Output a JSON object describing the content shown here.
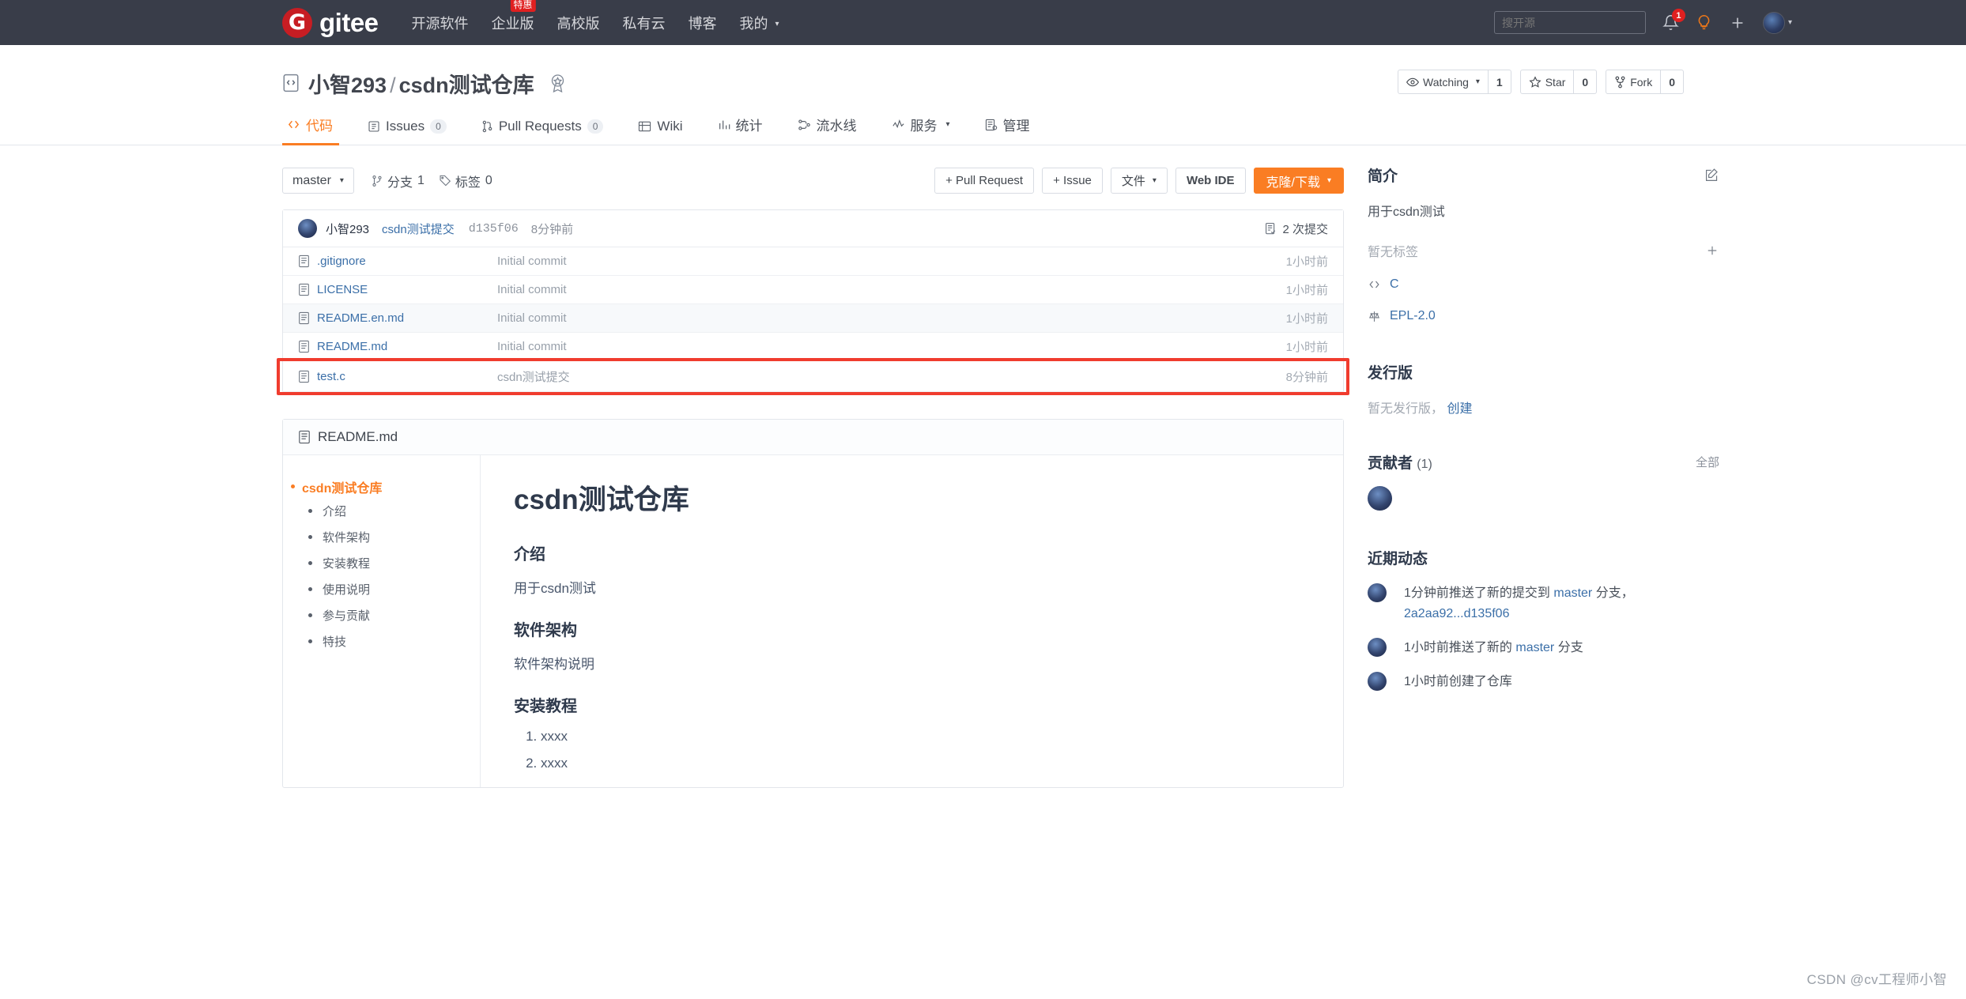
{
  "header": {
    "brand": "gitee",
    "logo_letter": "G",
    "nav": [
      {
        "label": "开源软件",
        "badge": null
      },
      {
        "label": "企业版",
        "badge": "特惠"
      },
      {
        "label": "高校版",
        "badge": null
      },
      {
        "label": "私有云",
        "badge": null
      },
      {
        "label": "博客",
        "badge": null
      },
      {
        "label": "我的",
        "badge": null,
        "caret": true
      }
    ],
    "search_placeholder": "搜开源",
    "notification_count": "1",
    "icons": {
      "bell": "bell-icon",
      "bulb": "lightbulb-icon",
      "plus": "plus-icon",
      "avatar": "user-avatar"
    }
  },
  "repo": {
    "owner": "小智293",
    "separator": "/",
    "name": "csdn测试仓库",
    "watch_label": "Watching",
    "watch_count": "1",
    "star_label": "Star",
    "star_count": "0",
    "fork_label": "Fork",
    "fork_count": "0"
  },
  "tabs": [
    {
      "label": "代码",
      "count": null,
      "active": true
    },
    {
      "label": "Issues",
      "count": "0",
      "active": false
    },
    {
      "label": "Pull Requests",
      "count": "0",
      "active": false
    },
    {
      "label": "Wiki",
      "count": null,
      "active": false
    },
    {
      "label": "统计",
      "count": null,
      "active": false
    },
    {
      "label": "流水线",
      "count": null,
      "active": false
    },
    {
      "label": "服务",
      "count": null,
      "active": false,
      "caret": true
    },
    {
      "label": "管理",
      "count": null,
      "active": false
    }
  ],
  "toolbar": {
    "branch": "master",
    "branches_label": "分支",
    "branches_count": "1",
    "tags_label": "标签",
    "tags_count": "0",
    "pull_request_btn": "+ Pull Request",
    "issue_btn": "+ Issue",
    "files_btn": "文件",
    "webide_btn": "Web IDE",
    "clone_btn": "克隆/下载"
  },
  "commit_bar": {
    "author": "小智293",
    "message": "csdn测试提交",
    "sha": "d135f06",
    "time": "8分钟前",
    "commits_count_label": "2 次提交"
  },
  "files": [
    {
      "name": ".gitignore",
      "message": "Initial commit",
      "time": "1小时前"
    },
    {
      "name": "LICENSE",
      "message": "Initial commit",
      "time": "1小时前"
    },
    {
      "name": "README.en.md",
      "message": "Initial commit",
      "time": "1小时前"
    },
    {
      "name": "README.md",
      "message": "Initial commit",
      "time": "1小时前"
    },
    {
      "name": "test.c",
      "message": "csdn测试提交",
      "time": "8分钟前",
      "highlighted": true
    }
  ],
  "readme": {
    "filename": "README.md",
    "toc_root": "csdn测试仓库",
    "toc_items": [
      "介绍",
      "软件架构",
      "安装教程",
      "使用说明",
      "参与贡献",
      "特技"
    ],
    "title": "csdn测试仓库",
    "sections": [
      {
        "heading": "介绍",
        "text": "用于csdn测试"
      },
      {
        "heading": "软件架构",
        "text": "软件架构说明"
      }
    ],
    "install_heading": "安装教程",
    "install_steps": [
      "xxxx",
      "xxxx"
    ]
  },
  "sidebar": {
    "intro_title": "简介",
    "intro_desc": "用于csdn测试",
    "no_tags": "暂无标签",
    "language": "C",
    "license": "EPL-2.0",
    "release_title": "发行版",
    "release_empty": "暂无发行版，",
    "release_create": "创建",
    "contrib_title": "贡献者",
    "contrib_count": "(1)",
    "contrib_all": "全部",
    "activity_title": "近期动态",
    "activities": [
      {
        "prefix": "1分钟前推送了新的提交到 ",
        "link1": "master",
        "mid": " 分支，",
        "link2": "2a2aa92...d135f06",
        "suffix": ""
      },
      {
        "prefix": "1小时前推送了新的 ",
        "link1": "master",
        "mid": " 分支",
        "link2": "",
        "suffix": ""
      },
      {
        "prefix": "1小时前创建了仓库",
        "link1": "",
        "mid": "",
        "link2": "",
        "suffix": ""
      }
    ]
  },
  "floating": {
    "help": "?",
    "edit_icon": "edit-icon",
    "chat_icon": "chat-icon"
  },
  "watermark": "CSDN @cv工程师小智",
  "colors": {
    "header_bg": "#393D49",
    "brand_red": "#C71D23",
    "accent_orange": "#FA7D23",
    "link_blue": "#3B6FA8",
    "annotation_red": "#F03C2E"
  }
}
